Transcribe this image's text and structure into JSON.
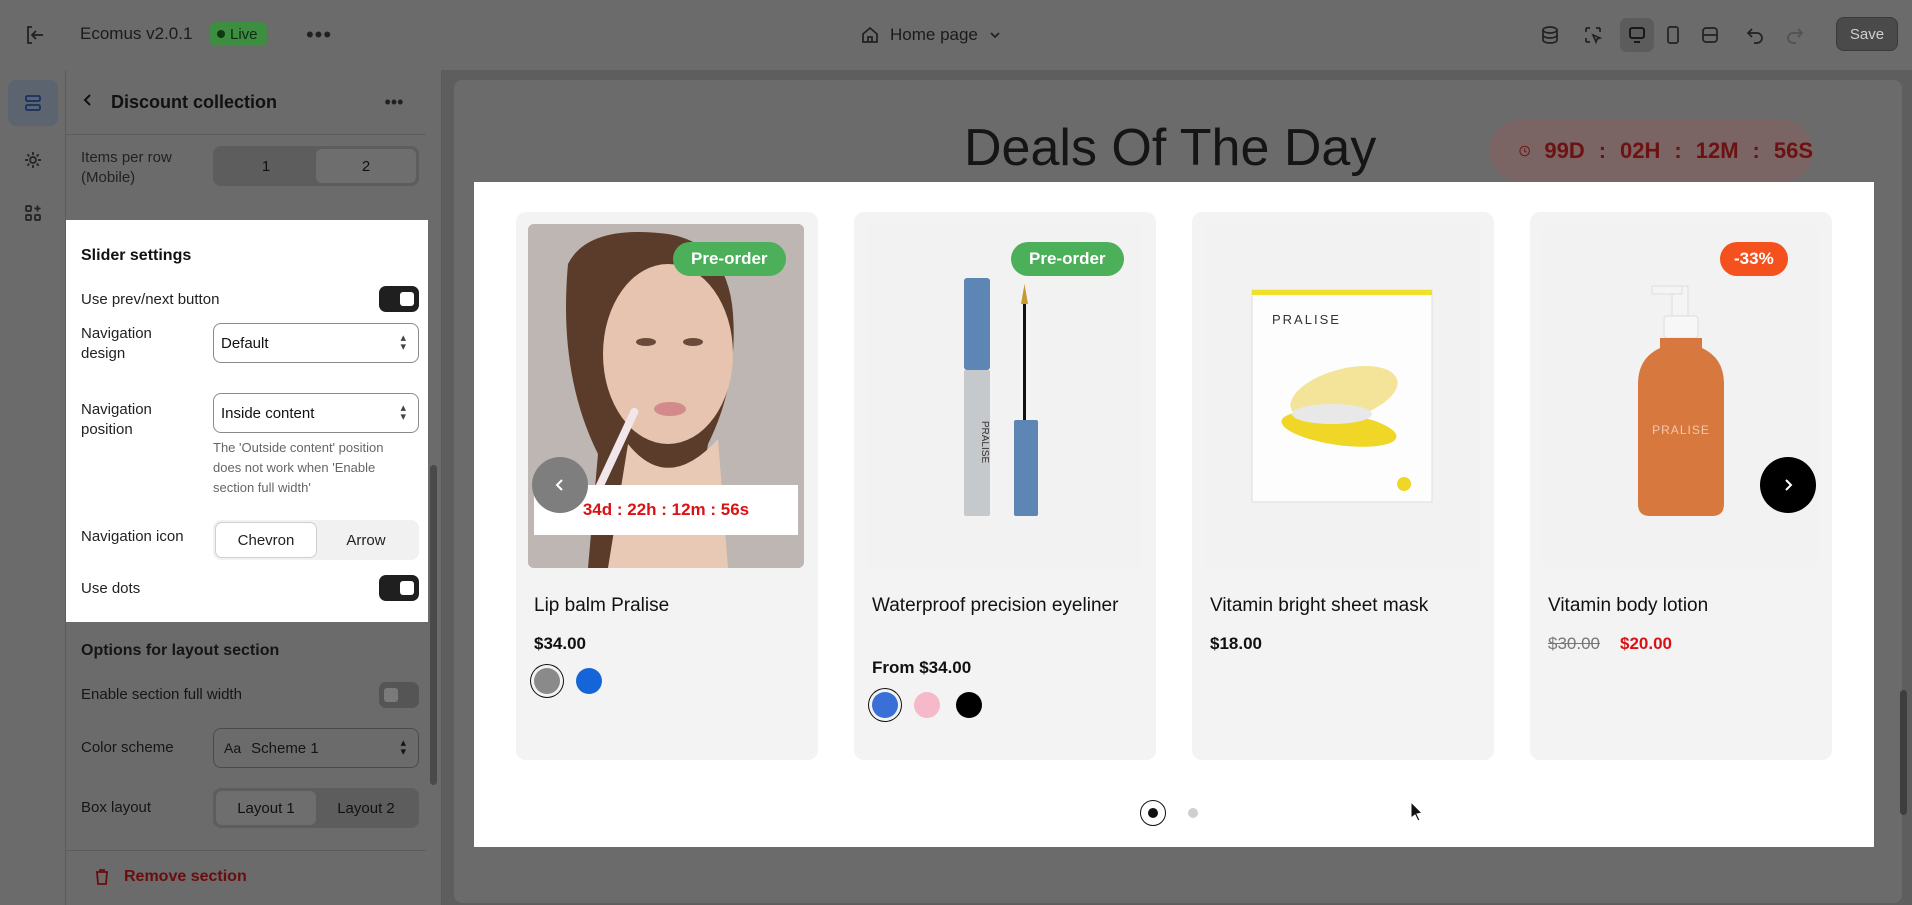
{
  "topbar": {
    "app_name": "Ecomus v2.0.1",
    "live_badge": "Live",
    "page_selector": "Home page",
    "save_label": "Save"
  },
  "panel": {
    "title": "Discount collection",
    "items_per_row_label": "Items per row (Mobile)",
    "items_per_row_options": [
      "1",
      "2"
    ],
    "items_per_row_selected": "2",
    "slider_heading": "Slider settings",
    "use_prev_next_label": "Use prev/next button",
    "navigation_design_label": "Navigation design",
    "navigation_design_value": "Default",
    "navigation_position_label": "Navigation position",
    "navigation_position_value": "Inside content",
    "navigation_position_help": "The 'Outside content' position does not work when 'Enable section full width'",
    "navigation_icon_label": "Navigation icon",
    "navigation_icon_options": [
      "Chevron",
      "Arrow"
    ],
    "navigation_icon_selected": "Chevron",
    "use_dots_label": "Use dots",
    "layout_heading": "Options for layout section",
    "full_width_label": "Enable section full width",
    "color_scheme_label": "Color scheme",
    "color_scheme_value": "Scheme 1",
    "box_layout_label": "Box layout",
    "box_layout_options": [
      "Layout 1",
      "Layout 2"
    ],
    "remove_section_label": "Remove section"
  },
  "preview": {
    "heading": "Deals Of The Day",
    "countdown": {
      "days": "99D",
      "hours": "02H",
      "minutes": "12M",
      "seconds": "56S",
      "sep": ":"
    },
    "products": [
      {
        "title": "Lip balm Pralise",
        "price": "$34.00",
        "badge": "Pre-order",
        "timer": "34d : 22h : 12m : 56s",
        "swatches": [
          "#8a8a8a",
          "#1565d8"
        ]
      },
      {
        "title": "Waterproof precision eyeliner",
        "price": "From $34.00",
        "badge": "Pre-order",
        "swatches": [
          "#3b6fd8",
          "#f6b9c9",
          "#000000"
        ]
      },
      {
        "title": "Vitamin bright sheet mask",
        "price": "$18.00",
        "image_text": "PRALISE"
      },
      {
        "title": "Vitamin body lotion",
        "old_price": "$30.00",
        "price": "$20.00",
        "badge": "-33%",
        "image_text": "PRALISE"
      }
    ],
    "eyeliner_text": "PRALISE"
  },
  "colors": {
    "badge_green": "#4caf5a",
    "badge_sale": "#f4511e",
    "sale_red": "#db1215",
    "live_green": "#3e8e41"
  }
}
